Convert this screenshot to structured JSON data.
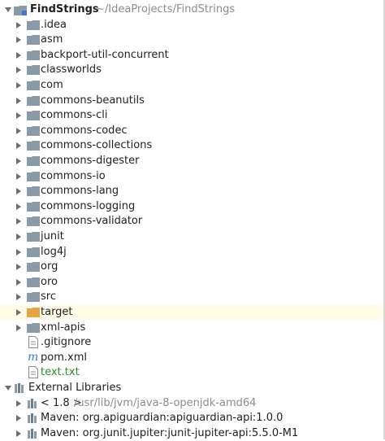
{
  "root": {
    "name": "FindStrings",
    "path": "~/IdeaProjects/FindStrings"
  },
  "folders": [
    ".idea",
    "asm",
    "backport-util-concurrent",
    "classworlds",
    "com",
    "commons-beanutils",
    "commons-cli",
    "commons-codec",
    "commons-collections",
    "commons-digester",
    "commons-io",
    "commons-lang",
    "commons-logging",
    "commons-validator",
    "junit",
    "log4j",
    "org",
    "oro",
    "src",
    "target",
    "xml-apis"
  ],
  "files": [
    ".gitignore",
    "pom.xml",
    "text.txt"
  ],
  "external": {
    "label": "External Libraries",
    "jdk": {
      "name": "< 1.8 >",
      "path": "/usr/lib/jvm/java-8-openjdk-amd64"
    },
    "libs": [
      "Maven: org.apiguardian:apiguardian-api:1.0.0",
      "Maven: org.junit.jupiter:junit-jupiter-api:5.5.0-M1"
    ]
  },
  "colors": {
    "folder": "#8a9aa8",
    "excluded_folder": "#e3a34a",
    "selected_row": "#fffbe6"
  }
}
